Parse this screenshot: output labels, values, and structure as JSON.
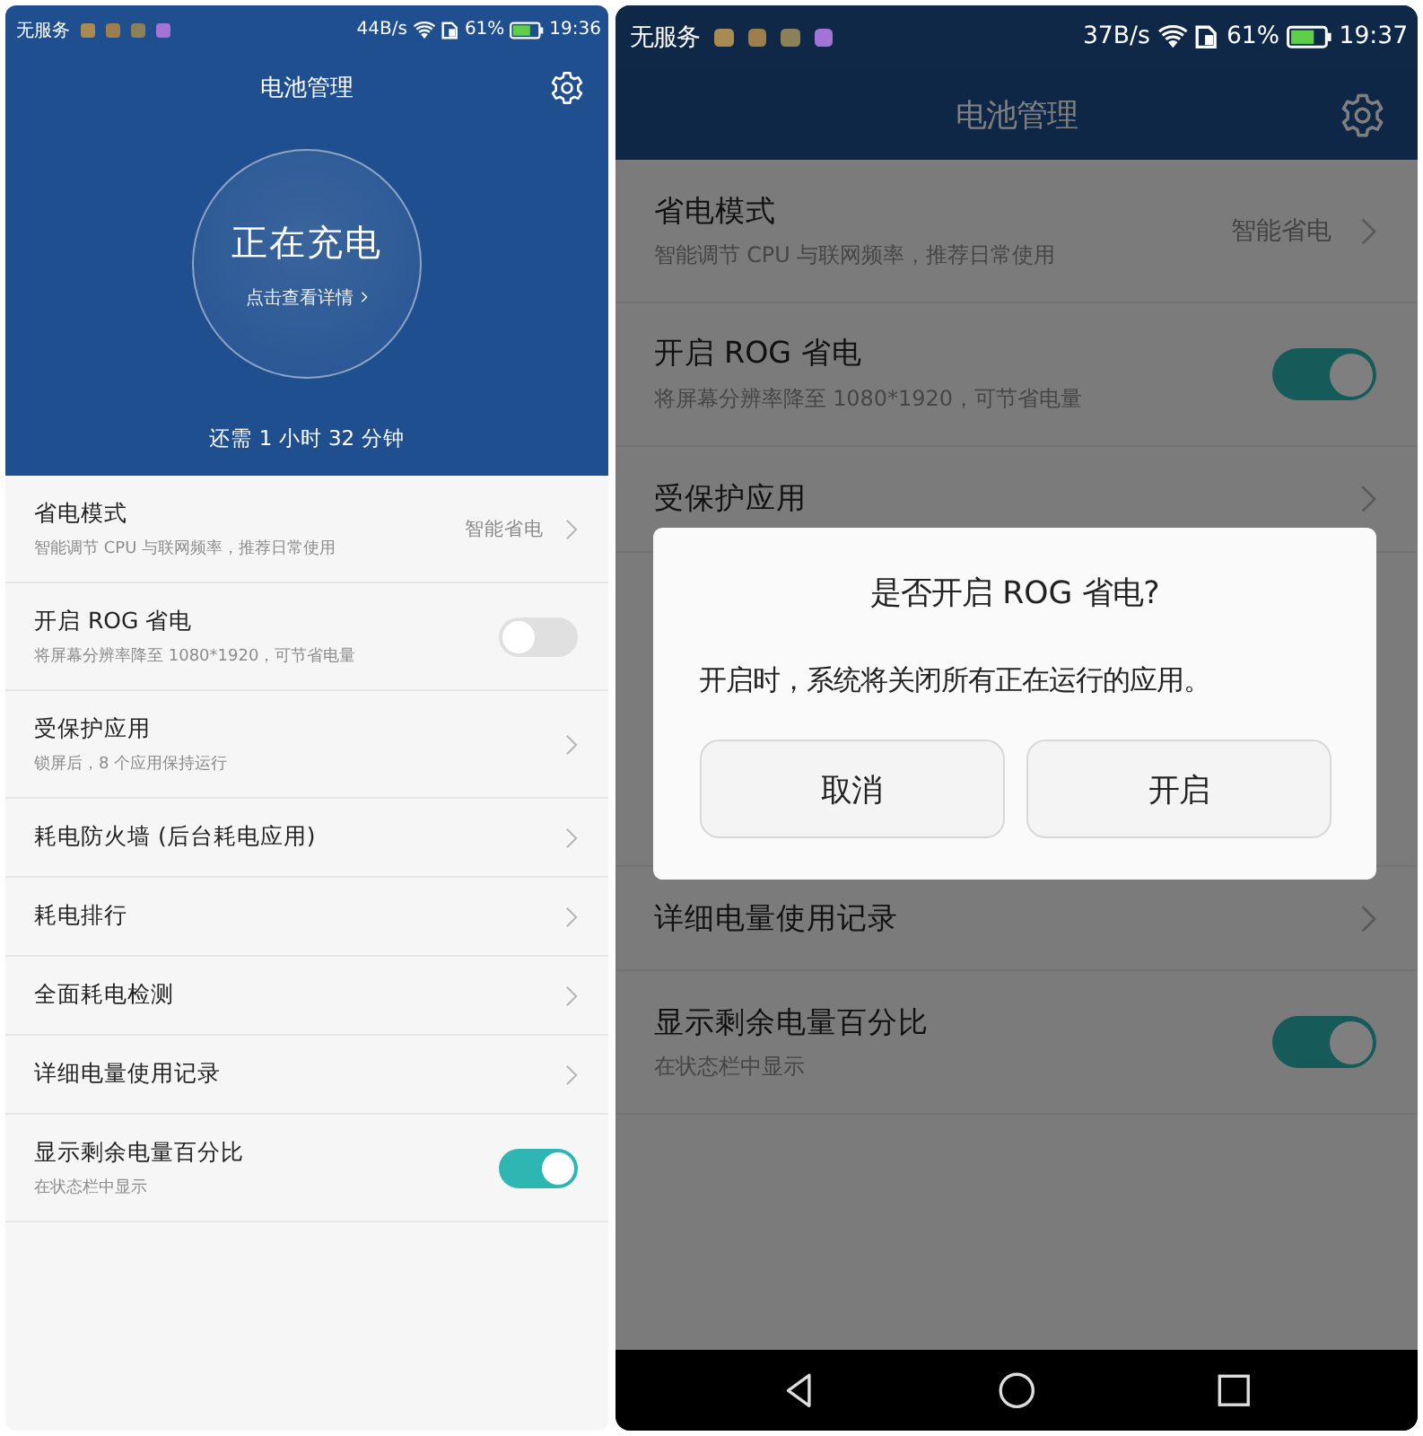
{
  "screens": [
    {
      "status_bar": {
        "carrier": "无服务",
        "notification_icons": [
          {
            "color": "#a88a52"
          },
          {
            "color": "#9c7f4c"
          },
          {
            "color": "#8c8058"
          },
          {
            "color": "#a374d6"
          }
        ],
        "speed": "44B/s",
        "battery": "61%",
        "time": "19:36"
      },
      "title": "电池管理",
      "charging": {
        "status": "正在充电",
        "details_link": "点击查看详情",
        "remaining": "还需 1 小时 32 分钟"
      },
      "items": [
        {
          "kind": "link",
          "title": "省电模式",
          "subtitle": "智能调节 CPU 与联网频率，推荐日常使用",
          "value": "智能省电"
        },
        {
          "kind": "toggle",
          "title": "开启 ROG 省电",
          "subtitle": "将屏幕分辨率降至 1080*1920，可节省电量",
          "on": false
        },
        {
          "kind": "link",
          "title": "受保护应用",
          "subtitle": "锁屏后，8 个应用保持运行"
        },
        {
          "kind": "link",
          "title": "耗电防火墙 (后台耗电应用)"
        },
        {
          "kind": "link",
          "title": "耗电排行"
        },
        {
          "kind": "link",
          "title": "全面耗电检测"
        },
        {
          "kind": "link",
          "title": "详细电量使用记录"
        },
        {
          "kind": "toggle",
          "title": "显示剩余电量百分比",
          "subtitle": "在状态栏中显示",
          "on": true
        }
      ],
      "nav_bar": false
    },
    {
      "status_bar": {
        "carrier": "无服务",
        "notification_icons": [
          {
            "color": "#a88a52"
          },
          {
            "color": "#9c7f4c"
          },
          {
            "color": "#8c8058"
          },
          {
            "color": "#a374d6"
          }
        ],
        "speed": "37B/s",
        "battery": "61%",
        "time": "19:37"
      },
      "title": "电池管理",
      "items": [
        {
          "kind": "link",
          "title": "省电模式",
          "subtitle": "智能调节 CPU 与联网频率，推荐日常使用",
          "value": "智能省电"
        },
        {
          "kind": "toggle",
          "title": "开启 ROG 省电",
          "subtitle": "将屏幕分辨率降至 1080*1920，可节省电量",
          "on": true
        },
        {
          "kind": "link",
          "title": "受保护应用"
        }
      ],
      "dialog": {
        "title": "是否开启 ROG 省电?",
        "message": "开启时，系统将关闭所有正在运行的应用。",
        "buttons": [
          "取消",
          "开启"
        ]
      },
      "items_below_dialog": [
        {
          "kind": "link",
          "title": "详细电量使用记录"
        },
        {
          "kind": "toggle",
          "title": "显示剩余电量百分比",
          "subtitle": "在状态栏中显示",
          "on": true
        }
      ],
      "nav_bar": true
    }
  ]
}
